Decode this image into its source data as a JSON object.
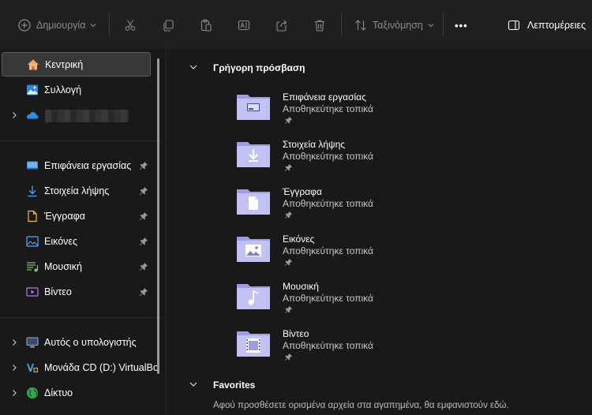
{
  "toolbar": {
    "new_label": "Δημιουργία",
    "sort_label": "Ταξινόμηση",
    "more_label": "•••",
    "details_label": "Λεπτομέρειες"
  },
  "sidebar": {
    "top_items": [
      {
        "label": "Κεντρική",
        "icon": "home-icon"
      },
      {
        "label": "Συλλογή",
        "icon": "gallery-icon"
      },
      {
        "label": "",
        "icon": "onedrive-icon"
      }
    ],
    "pinned_items": [
      {
        "label": "Επιφάνεια εργασίας",
        "icon": "desktop-icon"
      },
      {
        "label": "Στοιχεία λήψης",
        "icon": "download-icon"
      },
      {
        "label": "Έγγραφα",
        "icon": "document-icon"
      },
      {
        "label": "Εικόνες",
        "icon": "pictures-icon"
      },
      {
        "label": "Μουσική",
        "icon": "music-icon"
      },
      {
        "label": "Βίντεο",
        "icon": "video-icon"
      }
    ],
    "bottom_items": [
      {
        "label": "Αυτός ο υπολογιστής",
        "icon": "computer-icon"
      },
      {
        "label": "Μονάδα CD (D:) VirtualBo",
        "icon": "cd-drive-icon"
      },
      {
        "label": "Δίκτυο",
        "icon": "network-icon"
      }
    ]
  },
  "main": {
    "quick_access_title": "Γρήγορη πρόσβαση",
    "quick_access": [
      {
        "name": "Επιφάνεια εργασίας",
        "sub": "Αποθηκεύτηκε τοπικά",
        "icon": "desktop-folder-icon"
      },
      {
        "name": "Στοιχεία λήψης",
        "sub": "Αποθηκεύτηκε τοπικά",
        "icon": "downloads-folder-icon"
      },
      {
        "name": "Έγγραφα",
        "sub": "Αποθηκεύτηκε τοπικά",
        "icon": "documents-folder-icon"
      },
      {
        "name": "Εικόνες",
        "sub": "Αποθηκεύτηκε τοπικά",
        "icon": "pictures-folder-icon"
      },
      {
        "name": "Μουσική",
        "sub": "Αποθηκεύτηκε τοπικά",
        "icon": "music-folder-icon"
      },
      {
        "name": "Βίντεο",
        "sub": "Αποθηκεύτηκε τοπικά",
        "icon": "videos-folder-icon"
      }
    ],
    "favorites_title": "Favorites",
    "favorites_empty": "Αφού προσθέσετε ορισμένα αρχεία στα αγαπημένα, θα εμφανιστούν εδώ."
  },
  "colors": {
    "background": "#191919",
    "toolbar": "#202020",
    "selected": "#383838",
    "folder": "#b8b8f0",
    "accent_blue": "#4aa3f5"
  }
}
